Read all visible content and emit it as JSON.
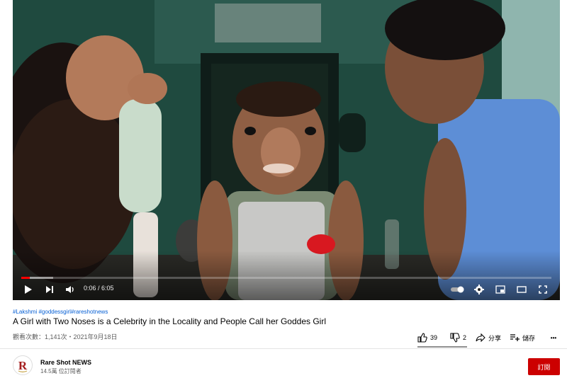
{
  "player": {
    "time_display": "0:06 / 6:05",
    "progress_fraction": 0.016,
    "buffered_fraction": 0.06,
    "accent_color": "#ff0000"
  },
  "controls": {
    "left": [
      "play-icon",
      "next-icon",
      "volume-icon"
    ],
    "right": [
      "autoplay-toggle-icon",
      "settings-icon",
      "miniplayer-icon",
      "theater-icon",
      "fullscreen-icon"
    ]
  },
  "video": {
    "hashtags": [
      "#Lakshmi",
      "#goddessgirl",
      "#rareshotnews"
    ],
    "title": "A Girl with Two Noses is a Celebrity in the Locality and People Call her Goddes Girl",
    "stats": "觀看次數：1,141次・2021年9月18日"
  },
  "actions": {
    "like_count": "39",
    "dislike_count": "2",
    "share_label": "分享",
    "save_label": "儲存",
    "more_label": "•••"
  },
  "channel": {
    "name": "Rare Shot NEWS",
    "subscribers": "14.5萬 位訂閱者",
    "subscribe_label": "訂閱",
    "subscribe_color": "#cc0000"
  }
}
